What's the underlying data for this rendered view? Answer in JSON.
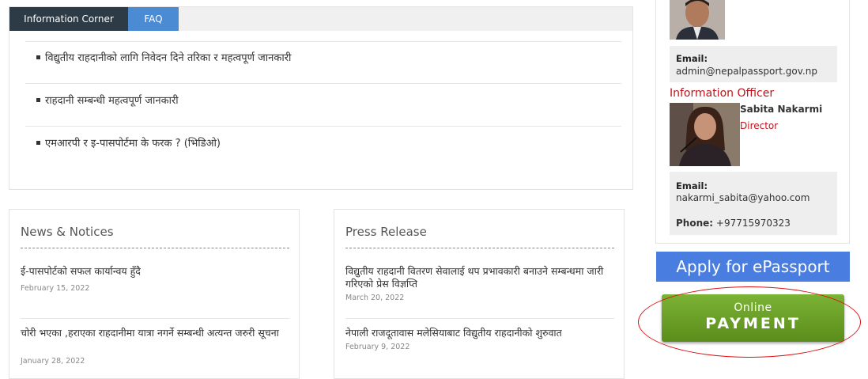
{
  "info_corner": {
    "tabs": [
      {
        "label": "Information Corner"
      },
      {
        "label": "FAQ"
      }
    ],
    "items": [
      {
        "text": "विद्युतीय राहदानीको लागि निवेदन दिने तरिका र महत्वपूर्ण जानकारी"
      },
      {
        "text": "राहदानी सम्बन्धी महत्वपूर्ण जानकारी"
      },
      {
        "text": "एमआरपी र इ-पासपोर्टमा के फरक ? (भिडिओ)"
      }
    ]
  },
  "news": {
    "title": "News & Notices",
    "entries": [
      {
        "title": "ई-पासपोर्टको सफल कार्यान्वय हुँदै",
        "date": "February 15, 2022"
      },
      {
        "title": "चोरी भएका ,हराएका राहदानीमा यात्रा नगर्ने सम्बन्धी अत्यन्त जरुरी सूचना",
        "date": "January 28, 2022"
      }
    ]
  },
  "press": {
    "title": "Press Release",
    "entries": [
      {
        "title": "विद्युतीय राहदानी वितरण सेवालाई थप प्रभावकारी बनाउने सम्बन्धमा जारी गरिएको प्रेस विज्ञप्ति",
        "date": "March 20, 2022"
      },
      {
        "title": "नेपाली राजदूतावास मलेसियाबाट विद्युतीय राहदानीको शुरुवात",
        "date": "February 9, 2022"
      }
    ]
  },
  "sidebar": {
    "admin": {
      "email_label": "Email:",
      "email": "admin@nepalpassport.gov.np"
    },
    "info_officer": {
      "heading": "Information Officer",
      "name": "Sabita Nakarmi",
      "role": "Director",
      "email_label": "Email:",
      "email": "nakarmi_sabita@yahoo.com",
      "phone_label": "Phone:",
      "phone": "+97715970323"
    }
  },
  "apply_button": {
    "label": "Apply for ePassport"
  },
  "payment_button": {
    "line1": "Online",
    "line2": "PAYMENT"
  },
  "colors": {
    "tab_active": "#2d3b47",
    "tab_faq": "#4a8bd4",
    "accent_red": "#c0121a",
    "apply_blue": "#4a7de0",
    "payment_green": "#6aa128"
  }
}
